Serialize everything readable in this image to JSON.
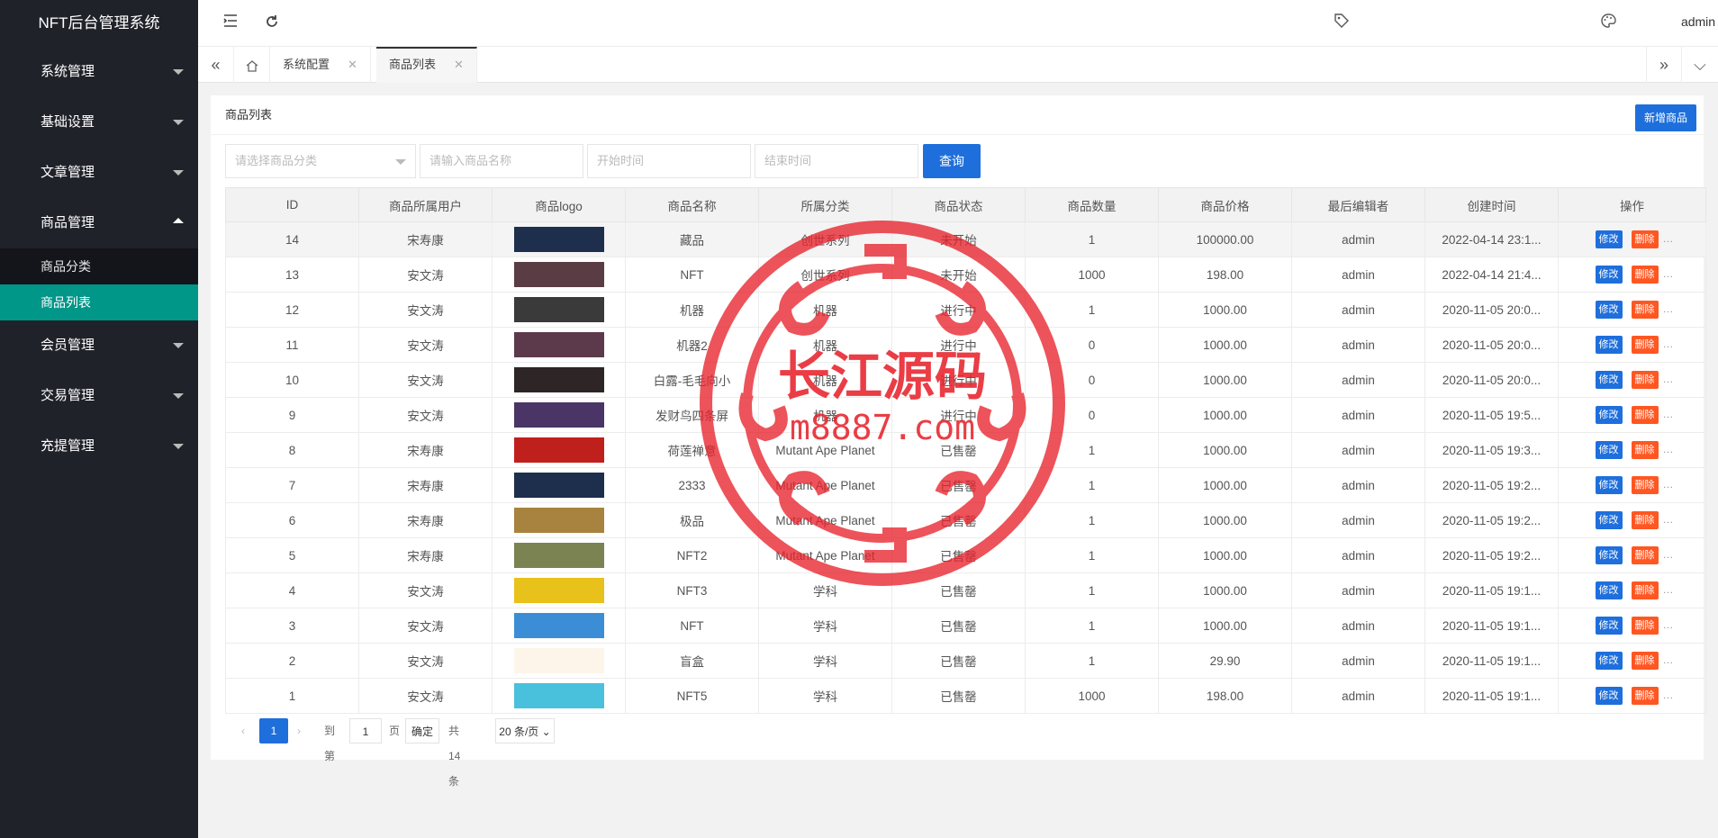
{
  "app": {
    "title": "NFT后台管理系统",
    "user": "admin"
  },
  "sidebar": {
    "items": [
      {
        "label": "系统管理"
      },
      {
        "label": "基础设置"
      },
      {
        "label": "文章管理"
      },
      {
        "label": "商品管理",
        "open": true,
        "children": [
          {
            "label": "商品分类"
          },
          {
            "label": "商品列表",
            "active": true
          }
        ]
      },
      {
        "label": "会员管理"
      },
      {
        "label": "交易管理"
      },
      {
        "label": "充提管理"
      }
    ]
  },
  "tabs": [
    {
      "label": "系统配置"
    },
    {
      "label": "商品列表",
      "active": true
    }
  ],
  "card": {
    "title": "商品列表",
    "new_button": "新增商品"
  },
  "search": {
    "category_placeholder": "请选择商品分类",
    "name_placeholder": "请输入商品名称",
    "start_placeholder": "开始时间",
    "end_placeholder": "结束时间",
    "query_button": "查询"
  },
  "table": {
    "columns": [
      "ID",
      "商品所属用户",
      "商品logo",
      "商品名称",
      "所属分类",
      "商品状态",
      "商品数量",
      "商品价格",
      "最后编辑者",
      "创建时间",
      "操作"
    ],
    "edit_label": "修改",
    "delete_label": "删除",
    "rows": [
      {
        "id": "14",
        "user": "宋寿康",
        "name": "藏品",
        "category": "创世系列",
        "status": "未开始",
        "qty": "1",
        "price": "100000.00",
        "editor": "admin",
        "created": "2022-04-14 23:1...",
        "logo": "#1d2f4c"
      },
      {
        "id": "13",
        "user": "安文涛",
        "name": "NFT",
        "category": "创世系列",
        "status": "未开始",
        "qty": "1000",
        "price": "198.00",
        "editor": "admin",
        "created": "2022-04-14 21:4...",
        "logo": "#5a3c45"
      },
      {
        "id": "12",
        "user": "安文涛",
        "name": "机器",
        "category": "机器",
        "status": "进行中",
        "qty": "1",
        "price": "1000.00",
        "editor": "admin",
        "created": "2020-11-05 20:0...",
        "logo": "#3a3a3a"
      },
      {
        "id": "11",
        "user": "安文涛",
        "name": "机器2",
        "category": "机器",
        "status": "进行中",
        "qty": "0",
        "price": "1000.00",
        "editor": "admin",
        "created": "2020-11-05 20:0...",
        "logo": "#5c3a4c"
      },
      {
        "id": "10",
        "user": "安文涛",
        "name": "白露-毛毛向小",
        "category": "机器",
        "status": "进行中",
        "qty": "0",
        "price": "1000.00",
        "editor": "admin",
        "created": "2020-11-05 20:0...",
        "logo": "#2e2626"
      },
      {
        "id": "9",
        "user": "安文涛",
        "name": "发财鸟四条屏",
        "category": "机器",
        "status": "进行中",
        "qty": "0",
        "price": "1000.00",
        "editor": "admin",
        "created": "2020-11-05 19:5...",
        "logo": "#4a3566"
      },
      {
        "id": "8",
        "user": "宋寿康",
        "name": "荷莲禅意",
        "category": "Mutant Ape Planet",
        "status": "已售罄",
        "qty": "1",
        "price": "1000.00",
        "editor": "admin",
        "created": "2020-11-05 19:3...",
        "logo": "#c0201c"
      },
      {
        "id": "7",
        "user": "宋寿康",
        "name": "2333",
        "category": "Mutant Ape Planet",
        "status": "已售罄",
        "qty": "1",
        "price": "1000.00",
        "editor": "admin",
        "created": "2020-11-05 19:2...",
        "logo": "#1d2f4c"
      },
      {
        "id": "6",
        "user": "宋寿康",
        "name": "极品",
        "category": "Mutant Ape Planet",
        "status": "已售罄",
        "qty": "1",
        "price": "1000.00",
        "editor": "admin",
        "created": "2020-11-05 19:2...",
        "logo": "#a8823f"
      },
      {
        "id": "5",
        "user": "宋寿康",
        "name": "NFT2",
        "category": "Mutant Ape Planet",
        "status": "已售罄",
        "qty": "1",
        "price": "1000.00",
        "editor": "admin",
        "created": "2020-11-05 19:2...",
        "logo": "#7b8352"
      },
      {
        "id": "4",
        "user": "安文涛",
        "name": "NFT3",
        "category": "学科",
        "status": "已售罄",
        "qty": "1",
        "price": "1000.00",
        "editor": "admin",
        "created": "2020-11-05 19:1...",
        "logo": "#e8c11a"
      },
      {
        "id": "3",
        "user": "安文涛",
        "name": "NFT",
        "category": "学科",
        "status": "已售罄",
        "qty": "1",
        "price": "1000.00",
        "editor": "admin",
        "created": "2020-11-05 19:1...",
        "logo": "#3b8ed6"
      },
      {
        "id": "2",
        "user": "安文涛",
        "name": "盲盒",
        "category": "学科",
        "status": "已售罄",
        "qty": "1",
        "price": "29.90",
        "editor": "admin",
        "created": "2020-11-05 19:1...",
        "logo": "#fdf5ea"
      },
      {
        "id": "1",
        "user": "安文涛",
        "name": "NFT5",
        "category": "学科",
        "status": "已售罄",
        "qty": "1000",
        "price": "198.00",
        "editor": "admin",
        "created": "2020-11-05 19:1...",
        "logo": "#49c1dd"
      }
    ]
  },
  "pagination": {
    "current": "1",
    "goto_label": "到第",
    "goto_value": "1",
    "page_unit": "页",
    "confirm": "确定",
    "total": "共 14 条",
    "page_size": "20 条/页"
  },
  "watermark": {
    "text": "长江源码",
    "url": "m8887.com",
    "color": "#e8232c"
  }
}
